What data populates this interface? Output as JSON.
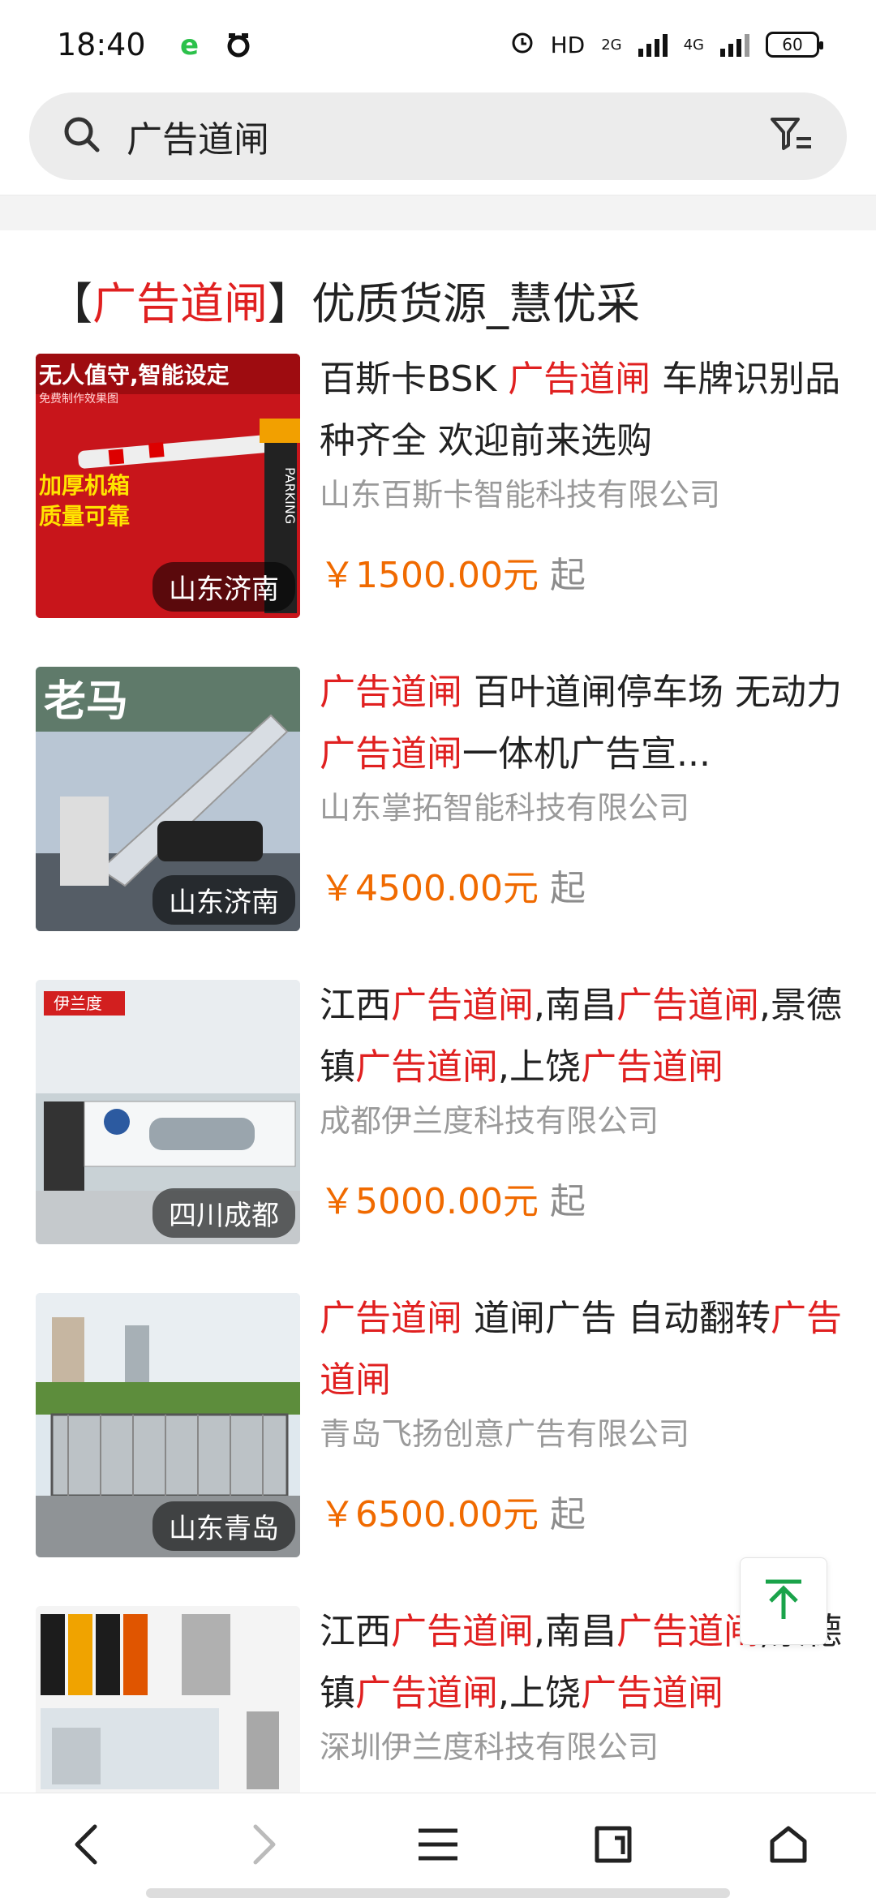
{
  "status": {
    "time": "18:40",
    "hd": "HD",
    "net1": "2G",
    "net2": "4G",
    "battery": "60"
  },
  "search": {
    "query": "广告道闸"
  },
  "header": {
    "bracket_open": "【",
    "keyword": "广告道闸",
    "bracket_close": "】",
    "rest": "优质货源_慧优采"
  },
  "products": [
    {
      "title_parts": [
        {
          "t": "百斯卡BSK ",
          "hl": false
        },
        {
          "t": "广告道闸",
          "hl": true
        },
        {
          "t": " 车牌识别品种齐全 欢迎前来选购",
          "hl": false
        }
      ],
      "company": "山东百斯卡智能科技有限公司",
      "price": "￥1500.00元",
      "suffix": "起",
      "location": "山东济南",
      "img_text": [
        "无人值守,智能设定",
        "免费制作效果图",
        "加厚机箱",
        "质量可靠",
        "PARKING"
      ]
    },
    {
      "title_parts": [
        {
          "t": "广告道闸",
          "hl": true
        },
        {
          "t": " 百叶道闸停车场 无动力",
          "hl": false
        },
        {
          "t": "广告道闸",
          "hl": true
        },
        {
          "t": "一体机广告宣...",
          "hl": false
        }
      ],
      "company": "山东掌拓智能科技有限公司",
      "price": "￥4500.00元",
      "suffix": "起",
      "location": "山东济南",
      "img_text": [
        "老马"
      ]
    },
    {
      "title_parts": [
        {
          "t": "江西",
          "hl": false
        },
        {
          "t": "广告道闸",
          "hl": true
        },
        {
          "t": ",南昌",
          "hl": false
        },
        {
          "t": "广告道闸",
          "hl": true
        },
        {
          "t": ",景德镇",
          "hl": false
        },
        {
          "t": "广告道闸",
          "hl": true
        },
        {
          "t": ",上饶",
          "hl": false
        },
        {
          "t": "广告道闸",
          "hl": true
        }
      ],
      "company": "成都伊兰度科技有限公司",
      "price": "￥5000.00元",
      "suffix": "起",
      "location": "四川成都",
      "img_text": [
        "伊兰度"
      ]
    },
    {
      "title_parts": [
        {
          "t": "广告道闸",
          "hl": true
        },
        {
          "t": " 道闸广告 自动翻转",
          "hl": false
        },
        {
          "t": "广告道闸",
          "hl": true
        }
      ],
      "company": "青岛飞扬创意广告有限公司",
      "price": "￥6500.00元",
      "suffix": "起",
      "location": "山东青岛",
      "img_text": []
    },
    {
      "title_parts": [
        {
          "t": "江西",
          "hl": false
        },
        {
          "t": "广告道闸",
          "hl": true
        },
        {
          "t": ",南昌",
          "hl": false
        },
        {
          "t": "广告道闸",
          "hl": true
        },
        {
          "t": ",景德镇",
          "hl": false
        },
        {
          "t": "广告道闸",
          "hl": true
        },
        {
          "t": ",上饶",
          "hl": false
        },
        {
          "t": "广告道闸",
          "hl": true
        }
      ],
      "company": "深圳伊兰度科技有限公司",
      "price": "",
      "suffix": "",
      "location": "",
      "img_text": []
    }
  ],
  "colors": {
    "highlight": "#e02020",
    "price": "#f06a00",
    "company": "#9a9a9a",
    "to_top": "#1aa34a"
  },
  "icons": {
    "search": "search-icon",
    "filter": "filter-icon",
    "back": "chevron-left-icon",
    "forward": "chevron-right-icon",
    "menu": "menu-icon",
    "tabs": "tabs-icon",
    "home": "home-icon",
    "to_top": "arrow-up-icon"
  }
}
